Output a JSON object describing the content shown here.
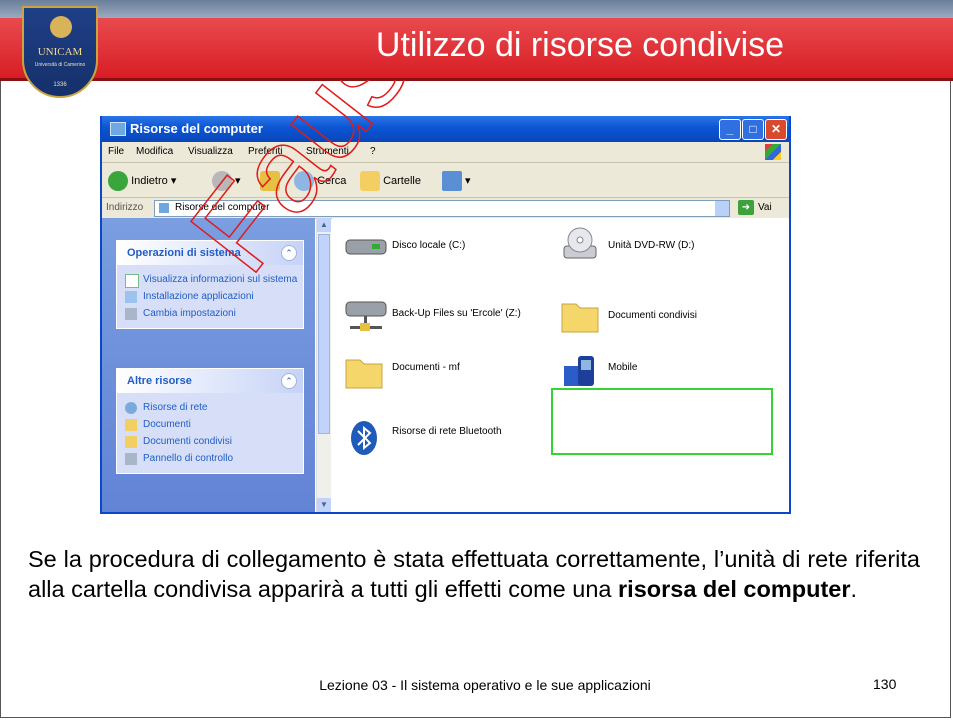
{
  "slide": {
    "title": "Utilizzo di risorse condivise",
    "logo": {
      "name": "UNICAM",
      "subtitle": "Università di Camerino",
      "year": "1336"
    },
    "watermark": "Fausto",
    "paragraph": {
      "before": "Se la procedura di collegamento è stata effettuata correttamente, l’unità di rete riferita alla cartella condivisa apparirà a tutti gli effetti come una ",
      "bold": "risorsa del computer",
      "after": "."
    },
    "footer": "Lezione 03 - Il sistema operativo e le sue applicazioni",
    "page_number": "130"
  },
  "window": {
    "title": "Risorse del computer",
    "menu": [
      "File",
      "Modifica",
      "Visualizza",
      "Preferiti",
      "Strumenti",
      "?"
    ],
    "toolbar": {
      "back": "Indietro",
      "search": "Cerca",
      "folders": "Cartelle"
    },
    "address": {
      "label": "Indirizzo",
      "value": "Risorse del computer",
      "go": "Vai"
    },
    "tasks": {
      "system": {
        "title": "Operazioni di sistema",
        "links": [
          "Visualizza informazioni sul sistema",
          "Installazione applicazioni",
          "Cambia impostazioni"
        ]
      },
      "other": {
        "title": "Altre risorse",
        "links": [
          "Risorse di rete",
          "Documenti",
          "Documenti condivisi",
          "Pannello di controllo"
        ]
      }
    },
    "items": [
      {
        "label": "Disco locale (C:)",
        "icon": "hard-drive-icon"
      },
      {
        "label": "Unità DVD-RW (D:)",
        "icon": "dvd-drive-icon"
      },
      {
        "label": "Back-Up Files su 'Ercole' (Z:)",
        "icon": "network-drive-icon"
      },
      {
        "label": "Documenti condivisi",
        "icon": "folder-icon"
      },
      {
        "label": "Documenti - mf",
        "icon": "folder-icon"
      },
      {
        "label": "Mobile",
        "icon": "mobile-device-icon"
      },
      {
        "label": "Risorse di rete Bluetooth",
        "icon": "bluetooth-icon"
      }
    ]
  },
  "colors": {
    "title_band": "#d81e24",
    "xp_blue": "#0a48c8",
    "highlight": "#33d433",
    "watermark": "#e11a1a"
  }
}
